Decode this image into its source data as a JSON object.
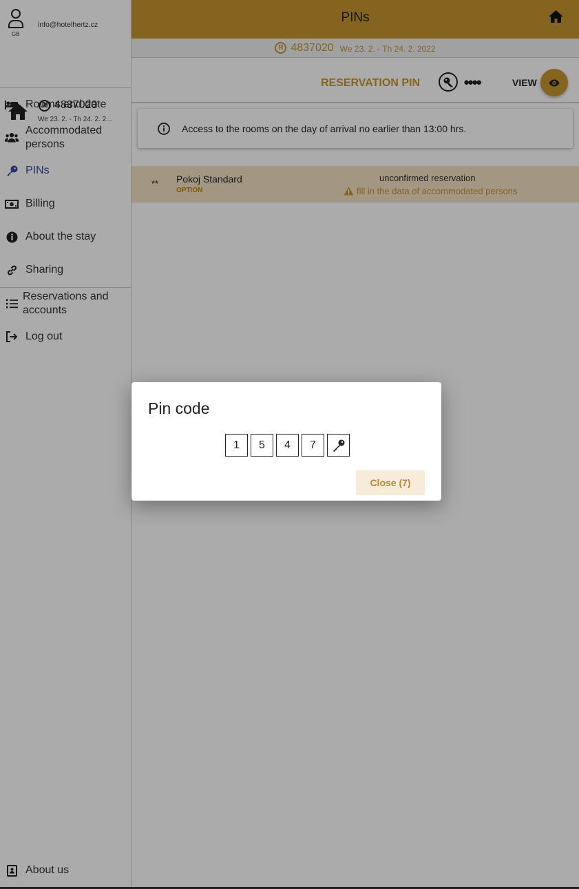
{
  "user": {
    "email": "info@hotelhertz.cz",
    "lang": "GB"
  },
  "reservation": {
    "number": "4837020",
    "dates_short": "We 23. 2. - Th 24. 2. 2...",
    "dates": "We 23. 2. - Th 24. 2. 2022"
  },
  "sidebar": {
    "items": [
      {
        "label": "Rooms and date",
        "icon": "bed-icon"
      },
      {
        "label": "Accommodated persons",
        "icon": "users-icon"
      },
      {
        "label": "PINs",
        "icon": "key-icon",
        "active": true
      },
      {
        "label": "Billing",
        "icon": "money-icon"
      },
      {
        "label": "About the stay",
        "icon": "info-icon"
      },
      {
        "label": "Sharing",
        "icon": "link-icon"
      }
    ],
    "secondary": [
      {
        "label": "Reservations and accounts",
        "icon": "list-icon"
      },
      {
        "label": "Log out",
        "icon": "logout-icon"
      }
    ],
    "footer": {
      "label": "About us",
      "icon": "contact-book-icon"
    }
  },
  "header": {
    "title": "PINs"
  },
  "pin_section": {
    "title": "RESERVATION PIN",
    "masked": "●●●●",
    "view_label": "VIEW"
  },
  "info": {
    "text": "Access to the rooms on the day of arrival no earlier than 13:00 hrs."
  },
  "room": {
    "stars": "**",
    "name": "Pokoj Standard",
    "type": "OPTION",
    "status": "unconfirmed reservation",
    "warning": "fill in the data of accommodated persons"
  },
  "dialog": {
    "title": "Pin code",
    "digits": [
      "1",
      "5",
      "4",
      "7"
    ],
    "close_label": "Close (7)"
  },
  "colors": {
    "accent": "#c6962f",
    "active_nav": "#3a4a9a",
    "room_bg": "#f3e2c4"
  }
}
